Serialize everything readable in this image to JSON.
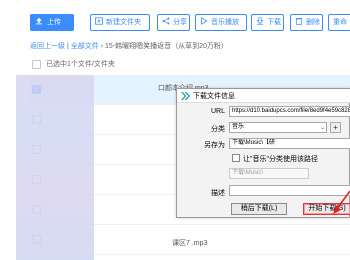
{
  "toolbar": {
    "upload": "上传",
    "new_folder": "新建文件夹",
    "share": "分享",
    "play_music": "音乐播放",
    "download": "下载",
    "delete": "删除",
    "rename": "重命"
  },
  "breadcrumb": {
    "back": "返回上一级",
    "all_files": "全部文件",
    "sep": " › ",
    "current": "15-韩曜翔嗯笑播返音（从草到20万粉）"
  },
  "select_status": "已选中1个文件/文件夹",
  "file_names": {
    "top": "口颜本介绍.mp3",
    "bottom": "课区7 .mp3"
  },
  "dialog": {
    "title": "下载文件信息",
    "url_label": "URL",
    "url_value": "https://d10.baidupcs.com/file/8ed9f4e59c8283",
    "category_label": "分类",
    "category_value": "音乐",
    "save_as_label": "另存为",
    "save_as_value": "下载\\Music\\【研",
    "remember_label": "让\"音乐\"分类使用该路径",
    "path_hint": "下载\\Music\\",
    "desc_label": "描述",
    "later_button": "稍后下载(L)",
    "start_button": "开始下载(S)"
  },
  "colors": {
    "accent": "#3b8cff",
    "selected_row": "#e5f2ff",
    "arrow": "#e02020"
  }
}
